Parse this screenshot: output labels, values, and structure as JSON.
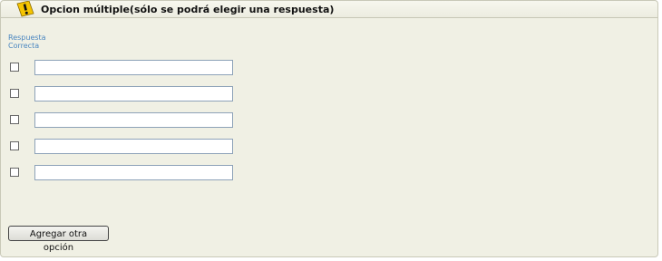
{
  "header": {
    "title": "Opcion múltiple(sólo se podrá elegir una respuesta)",
    "icon": "warning-icon",
    "icon_color": "#f5c400"
  },
  "column_header": {
    "line1": "Respuesta",
    "line2": "Correcta"
  },
  "options": [
    {
      "checked": false,
      "value": ""
    },
    {
      "checked": false,
      "value": ""
    },
    {
      "checked": false,
      "value": ""
    },
    {
      "checked": false,
      "value": ""
    },
    {
      "checked": false,
      "value": ""
    }
  ],
  "add_button_label": "Agregar otra opción",
  "colors": {
    "panel_bg": "#f0f0e4",
    "link_blue": "#4a86c0"
  }
}
